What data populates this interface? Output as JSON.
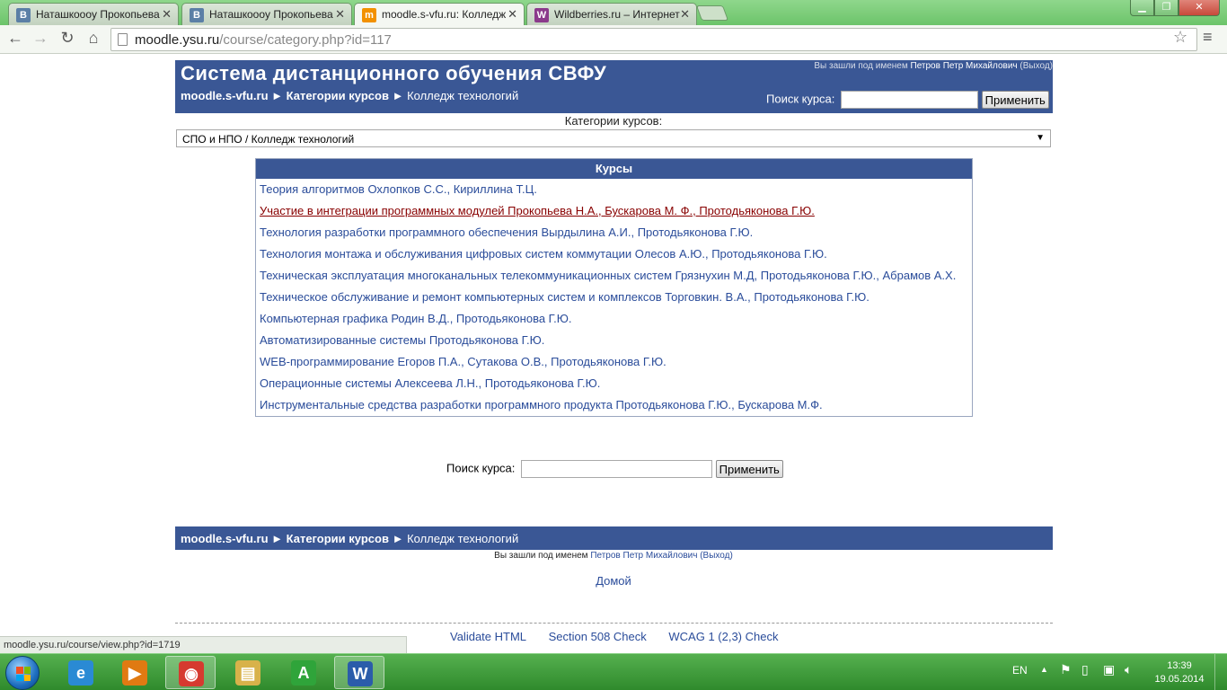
{
  "browser": {
    "tabs": [
      {
        "icon": "B",
        "icon_color": "#5b7fa6",
        "title": "Наташкoooy Прокопьева",
        "active": false
      },
      {
        "icon": "B",
        "icon_color": "#5b7fa6",
        "title": "Наташкoooy Прокопьева",
        "active": false
      },
      {
        "icon": "m",
        "icon_color": "#f29100",
        "title": "moodle.s-vfu.ru: Колледж",
        "active": true
      },
      {
        "icon": "W",
        "icon_color": "#8b3a8b",
        "title": "Wildberries.ru – Интернет",
        "active": false
      }
    ],
    "url_host": "moodle.ysu.ru",
    "url_path": "/course/category.php?id=117",
    "status_url": "moodle.ysu.ru/course/view.php?id=1719"
  },
  "header": {
    "site_title": "Система дистанционного обучения СВФУ",
    "breadcrumb": {
      "home": "moodle.s-vfu.ru",
      "sep": "►",
      "categories": "Категории курсов",
      "current": "Колледж технологий"
    },
    "login_prefix": "Вы зашли под именем",
    "login_user": "Петров Петр Михайлович",
    "logout": "(Выход)",
    "search_label": "Поиск курса:",
    "search_value": "",
    "search_button": "Применить"
  },
  "category": {
    "label": "Категории курсов:",
    "selected": "СПО и НПО / Колледж технологий"
  },
  "courses": {
    "heading": "Курсы",
    "items": [
      "Теория алгоритмов Охлопков С.С., Кириллина Т.Ц.",
      "Участие в интеграции программных модулей Прокопьева Н.А., Бускарова М. Ф., Протодьяконова Г.Ю.",
      "Технология разработки программного обеспечения Вырдылина А.И., Протодьяконова Г.Ю.",
      "Технология монтажа и обслуживания цифровых систем коммутации Олесов А.Ю., Протодьяконова Г.Ю.",
      "Техническая эксплуатация многоканальных телекоммуникационных систем Грязнухин М.Д, Протодьяконова Г.Ю., Абрамов А.Х.",
      "Техническое обслуживание и ремонт компьютерных систем и комплексов Торговкин. В.А., Протодьяконова Г.Ю.",
      "Компьютерная графика Родин В.Д., Протодьяконова Г.Ю.",
      "Автоматизированные системы Протодьяконова Г.Ю.",
      "WEB-программирование Егоров П.А., Сутакова О.В., Протодьяконова Г.Ю.",
      "Операционные системы Алексеева Л.Н., Протодьяконова Г.Ю.",
      "Инструментальные средства разработки программного продукта Протодьяконова Г.Ю., Бускарова М.Ф."
    ],
    "hovered_index": 1
  },
  "search_bottom": {
    "label": "Поиск курса:",
    "value": "",
    "button": "Применить"
  },
  "footer": {
    "breadcrumb": {
      "home": "moodle.s-vfu.ru",
      "sep": "►",
      "categories": "Категории курсов",
      "current": "Колледж технологий"
    },
    "login_prefix": "Вы зашли под именем",
    "login_user": "Петров Петр Михайлович",
    "logout": "(Выход)",
    "home_link": "Домой",
    "validators": [
      "Validate HTML",
      "Section 508 Check",
      "WCAG 1 (2,3) Check"
    ]
  },
  "taskbar": {
    "apps": [
      {
        "name": "internet-explorer",
        "glyph": "e",
        "color": "#2a8ad4"
      },
      {
        "name": "media-player",
        "glyph": "▶",
        "color": "#e07a12"
      },
      {
        "name": "chrome",
        "glyph": "◉",
        "color": "#d63a2f",
        "active": true
      },
      {
        "name": "file-explorer",
        "glyph": "▤",
        "color": "#d8b24a"
      },
      {
        "name": "green-a-app",
        "glyph": "A",
        "color": "#2fa43a"
      },
      {
        "name": "word",
        "glyph": "W",
        "color": "#2b5caa",
        "active": true
      }
    ],
    "lang": "EN",
    "time": "13:39",
    "date": "19.05.2014"
  }
}
